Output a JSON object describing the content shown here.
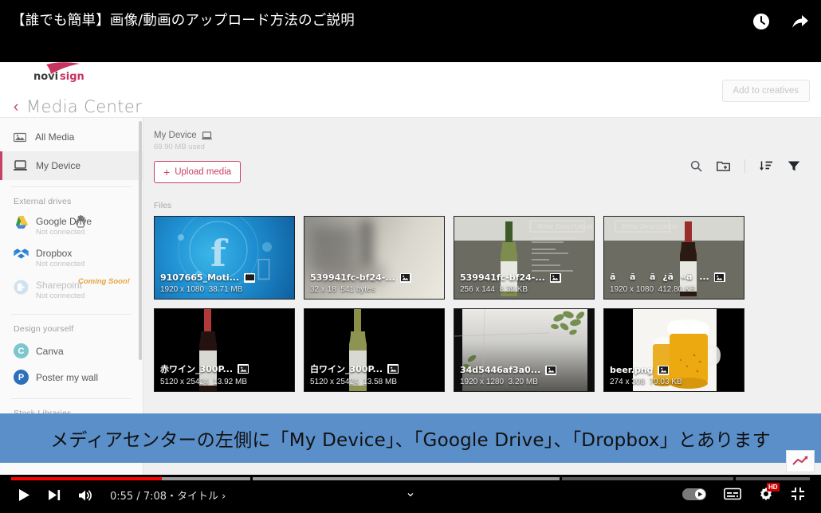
{
  "player": {
    "title": "【誰でも簡単】画像/動画のアップロード方法のご説明",
    "watch_later_icon": "clock-icon",
    "share_icon": "share-icon",
    "current_time": "0:55",
    "total_time": "7:08",
    "time_display": "0:55 / 7:08・タイトル ›",
    "play_icon": "play-icon",
    "next_icon": "next-video-icon",
    "volume_icon": "volume-icon",
    "autoplay_icon": "autoplay-toggle",
    "subtitles_icon": "subtitles-icon",
    "settings_icon": "settings-gear-icon",
    "quality_badge": "HD",
    "fullscreen_icon": "exit-fullscreen-icon",
    "expand_icon": "chevron-down-icon",
    "progress_percent": 13,
    "accent_color": "#ff0000"
  },
  "subtitle": {
    "text": "メディアセンターの左側に「My Device」、「Google Drive」、「Dropbox」とあります",
    "background": "#5b8fc9"
  },
  "app": {
    "brand": "novisign",
    "brand_color": "#c9335f",
    "page_title": "Media Center",
    "back_icon": "chevron-left-icon",
    "add_to_creatives_label": "Add to creatives"
  },
  "sidebar": {
    "primary": [
      {
        "label": "All Media",
        "icon": "all-media-icon",
        "active": false
      },
      {
        "label": "My Device",
        "icon": "laptop-icon",
        "active": true
      }
    ],
    "external_drives_title": "External drives",
    "external_drives": [
      {
        "label": "Google Drive",
        "status": "Not connected",
        "icon": "google-drive-icon",
        "disabled": false,
        "badge": ""
      },
      {
        "label": "Dropbox",
        "status": "Not connected",
        "icon": "dropbox-icon",
        "disabled": false,
        "badge": ""
      },
      {
        "label": "Sharepoint",
        "status": "Not connected",
        "icon": "sharepoint-icon",
        "disabled": true,
        "badge": "Coming Soon!"
      }
    ],
    "design_title": "Design yourself",
    "design_items": [
      {
        "label": "Canva",
        "icon": "canva-icon",
        "initial": "C",
        "color": "#7ec6cd"
      },
      {
        "label": "Poster my wall",
        "icon": "poster-my-wall-icon",
        "initial": "P",
        "color": "#2c6fbb"
      }
    ],
    "stock_title": "Stock Libraries"
  },
  "main": {
    "device_title": "My Device",
    "device_icon": "laptop-icon",
    "storage_used": "69.90 MB used",
    "upload_label": "Upload media",
    "upload_plus": "+",
    "files_label": "Files",
    "toolbar": [
      {
        "name": "search-icon",
        "label": "Search"
      },
      {
        "name": "new-folder-icon",
        "label": "New folder"
      },
      {
        "name": "sort-icon",
        "label": "Sort"
      },
      {
        "name": "filter-icon",
        "label": "Filter"
      }
    ],
    "files": [
      {
        "name": "9107665_Moti...",
        "dims": "1920 x 1080",
        "size": "38.71 MB",
        "type": "video",
        "art": "facebook-blue"
      },
      {
        "name": "539941fc-bf24-...",
        "dims": "32 x 18",
        "size": "541 bytes",
        "type": "image",
        "art": "blur-grey"
      },
      {
        "name": "539941fc-bf24-...",
        "dims": "256 x 144",
        "size": "8.39 KB",
        "type": "image",
        "art": "wine-white"
      },
      {
        "name": "ããã¿ã«ã...",
        "dims": "1920 x 1080",
        "size": "412.80 KB",
        "type": "image",
        "art": "wine-red"
      },
      {
        "name": "赤ワイン_300P...",
        "dims": "5120 x 25424",
        "size": "13.92 MB",
        "type": "image",
        "art": "bottle-red-dark"
      },
      {
        "name": "白ワイン_300P...",
        "dims": "5120 x 25424",
        "size": "13.58 MB",
        "type": "image",
        "art": "bottle-white-dark"
      },
      {
        "name": "34d5446af3a0...",
        "dims": "1920 x 1280",
        "size": "3.20 MB",
        "type": "image",
        "art": "wall-plant"
      },
      {
        "name": "beer.png",
        "dims": "274 x 308",
        "size": "79.03 KB",
        "type": "image",
        "art": "beer"
      }
    ]
  }
}
